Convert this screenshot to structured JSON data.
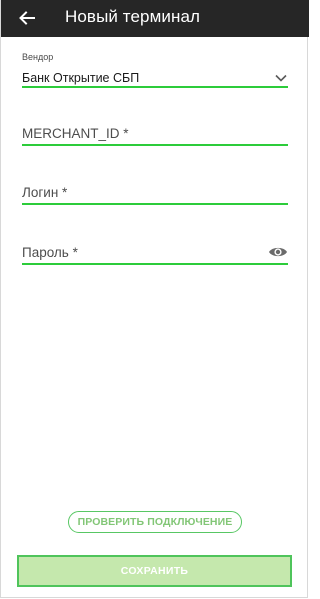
{
  "header": {
    "title": "Новый терминал",
    "back_icon": "arrow-left-icon"
  },
  "form": {
    "vendor": {
      "label": "Вендор",
      "value": "Банк Открытие СБП",
      "icon": "chevron-down-icon"
    },
    "merchant_id": {
      "placeholder": "MERCHANT_ID *",
      "value": ""
    },
    "login": {
      "placeholder": "Логин *",
      "value": ""
    },
    "password": {
      "placeholder": "Пароль *",
      "value": "",
      "icon": "eye-icon"
    }
  },
  "actions": {
    "check_connection_label": "ПРОВЕРИТЬ ПОДКЛЮЧЕНИЕ",
    "save_label": "СОХРАНИТЬ"
  },
  "colors": {
    "app_bar": "#262626",
    "accent": "#2ccc3a",
    "save_button_fill": "#c5e8ad"
  }
}
